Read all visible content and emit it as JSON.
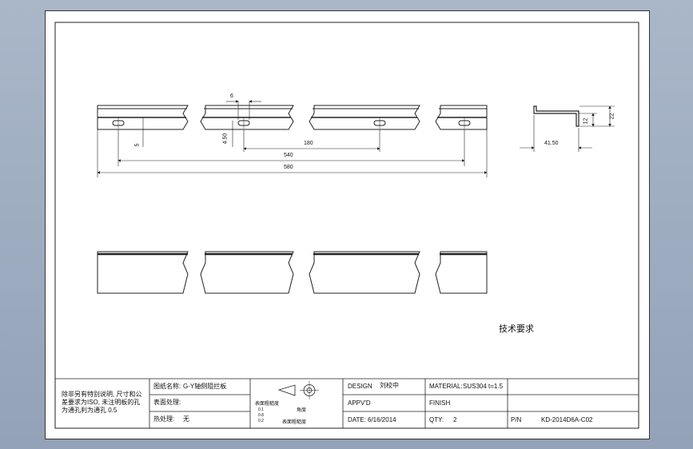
{
  "drawing": {
    "dimensions": {
      "hole_width": "6",
      "end_drop": "5",
      "hole_height": "4.50",
      "hole_pitch": "180",
      "hole_span": "540",
      "overall_length": "580",
      "section_width": "41.50",
      "section_height": "22",
      "section_flange": "12"
    },
    "tech_requirements_heading": "技术要求"
  },
  "title_block": {
    "notes": "除非另有特别说明, 尺寸和公差要求为ISO, 未注明板的孔为通孔利为通孔 0.5",
    "part_name_label": "图纸名称:",
    "part_name_value": "G-Y轴侧阻拦板",
    "surface_label": "表面处理:",
    "heat_label": "热处理:",
    "heat_value": "无",
    "roughness_label": "表面粗糙度",
    "roughness_values": [
      "0.1",
      "0.8",
      "0.2"
    ],
    "angle_label": "角度",
    "surface_finish_label": "表面粗糙度",
    "design_label": "DESIGN",
    "design_value": "刘校中",
    "approved_label": "APPV'D",
    "date_label": "DATE:",
    "date_value": "6/16/2014",
    "material_label": "MATERIAL:",
    "material_value": "SUS304 t=1.5",
    "finish_label": "FINISH",
    "qty_label": "QTY:",
    "qty_value": "2",
    "pn_label": "P/N",
    "pn_value": "KD-2014D6A-C02"
  }
}
